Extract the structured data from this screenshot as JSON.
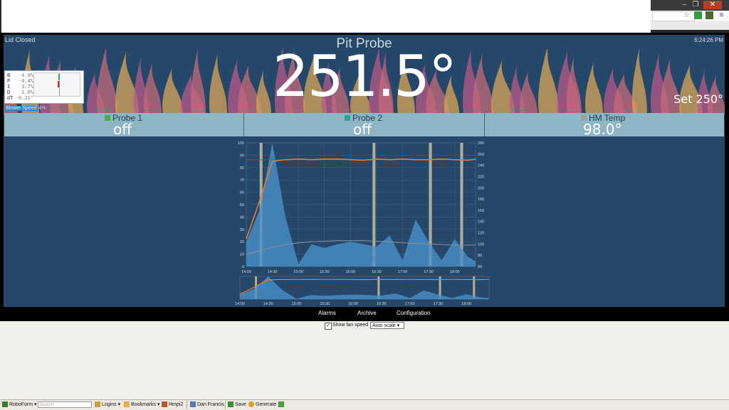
{
  "browser": {
    "minimize": "–",
    "restore": "❐",
    "close": "✕"
  },
  "status": {
    "lid": "Lid Closed",
    "time": "6:24:26 PM"
  },
  "pit": {
    "title": "Pit Probe",
    "temp": "251.5°",
    "setpoint": "Set 250°"
  },
  "pid": [
    {
      "k": "B",
      "v": "4.0%"
    },
    {
      "k": "P",
      "v": "-4.4%"
    },
    {
      "k": "I",
      "v": "3.7%"
    },
    {
      "k": "D",
      "v": "1.0%"
    },
    {
      "k": "dT",
      "v": "-0.21°"
    }
  ],
  "blower": {
    "label": "Blower Speed",
    "value": "4%"
  },
  "probes": [
    {
      "name": "Probe 1",
      "value": "off",
      "color": "#4caf50"
    },
    {
      "name": "Probe 2",
      "value": "off",
      "color": "#26a69a"
    },
    {
      "name": "HM Temp",
      "value": "98.0°",
      "color": "#9e9e9e"
    }
  ],
  "chart_data": {
    "type": "line",
    "x": [
      "14:00",
      "14:15",
      "14:30",
      "14:45",
      "15:00",
      "15:15",
      "15:30",
      "15:45",
      "16:00",
      "16:15",
      "16:30",
      "16:45",
      "17:00",
      "17:15",
      "17:30",
      "17:45",
      "18:00",
      "18:15",
      "18:24"
    ],
    "series": [
      {
        "axis": "right",
        "color": "#f07830",
        "values": [
          109,
          175,
          247,
          250,
          251,
          250,
          251,
          251,
          250,
          249,
          251,
          250,
          251,
          250,
          250,
          251,
          250,
          249,
          251
        ]
      },
      {
        "axis": "left",
        "color": "#4a90c8",
        "values": [
          20,
          45,
          100,
          40,
          2,
          18,
          15,
          18,
          20,
          18,
          16,
          25,
          5,
          38,
          20,
          5,
          22,
          8,
          4
        ]
      },
      {
        "axis": "right",
        "color": "#8a8f96",
        "values": [
          82,
          88,
          94,
          99,
          102,
          104,
          105,
          106,
          106,
          106,
          105,
          104,
          102,
          101,
          100,
          99,
          98,
          98,
          98
        ]
      }
    ],
    "y_left": {
      "ticks": [
        "0",
        "10",
        "20",
        "30",
        "40",
        "50",
        "60",
        "70",
        "80",
        "90",
        "100"
      ],
      "lim": [
        0,
        100
      ]
    },
    "y_right": {
      "ticks": [
        "60",
        "80",
        "100",
        "120",
        "140",
        "160",
        "180",
        "200",
        "220",
        "240",
        "260",
        "280"
      ],
      "lim": [
        60,
        280
      ]
    },
    "x_ticks": [
      "14:00",
      "14:30",
      "15:00",
      "15:30",
      "16:00",
      "16:30",
      "17:00",
      "17:30",
      "18:00"
    ],
    "lid_open_periods": [
      "14:17",
      "16:27",
      "17:32",
      "18:08"
    ],
    "grid": true
  },
  "footer": {
    "alarms": "Alarms",
    "archive": "Archive",
    "configuration": "Configuration"
  },
  "options": {
    "show_fan_speed": "Show fan speed",
    "scale": "Auto scale"
  },
  "taskbar": {
    "roboform": "RoboForm",
    "search_placeholder": "Search",
    "logins": "Logins",
    "bookmarks": "Bookmarks",
    "hmpi": "Hmpi2",
    "dan": "Dan Francis",
    "save": "Save",
    "generate": "Generate"
  }
}
